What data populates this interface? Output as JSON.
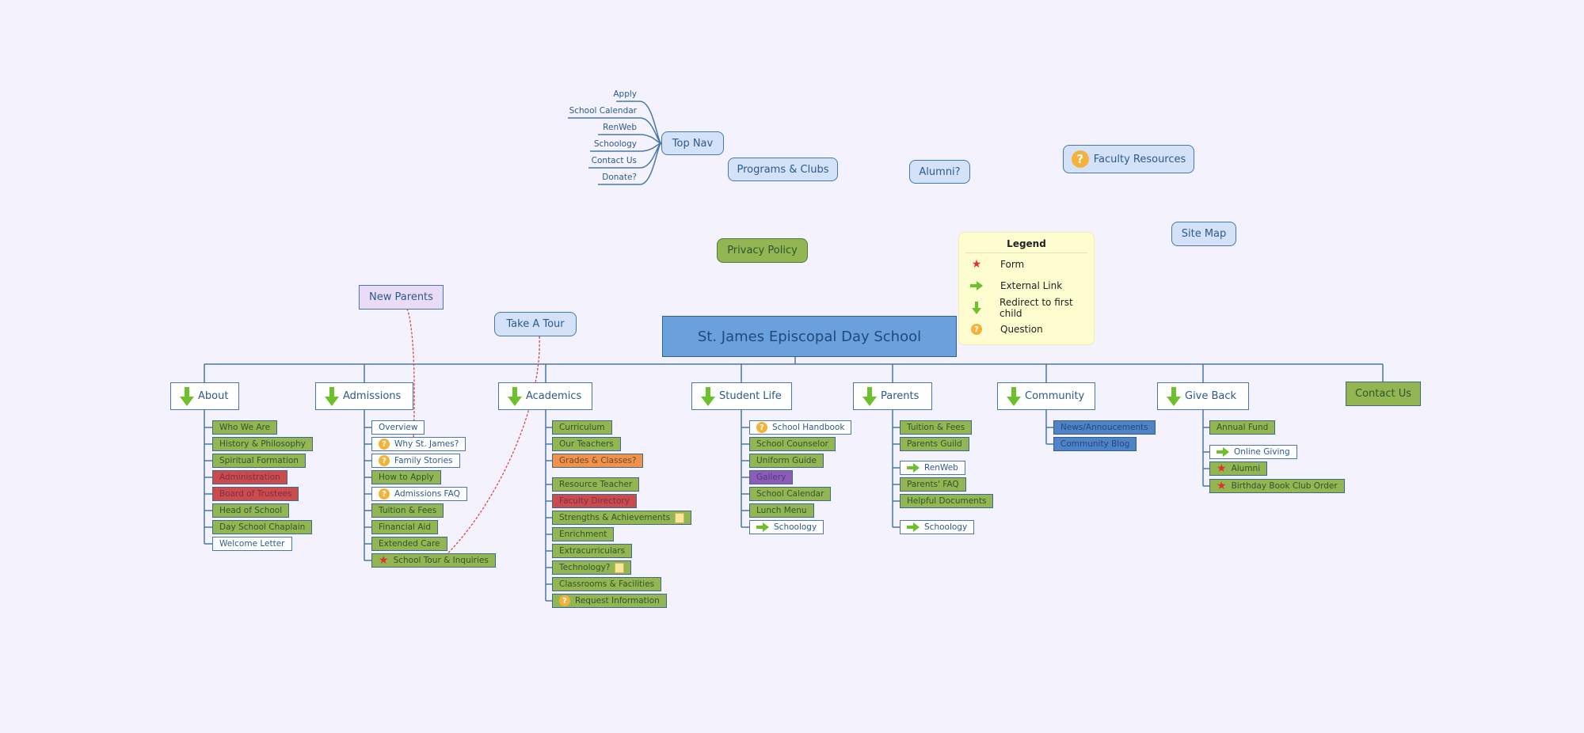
{
  "root": {
    "label": "St. James Episcopal Day School",
    "color": "#6aa0dc"
  },
  "floating": {
    "top_nav": "Top Nav",
    "programs_clubs": "Programs & Clubs",
    "alumni": "Alumni?",
    "faculty_resources": "Faculty Resources",
    "privacy_policy": "Privacy Policy",
    "site_map": "Site Map",
    "new_parents": "New Parents",
    "take_a_tour": "Take A Tour"
  },
  "top_nav_items": [
    "Apply",
    "School Calendar",
    "RenWeb",
    "Schoology",
    "Contact Us",
    "Donate?"
  ],
  "legend": {
    "title": "Legend",
    "items": [
      {
        "icon": "star-icon",
        "label": "Form"
      },
      {
        "icon": "arrow-right-icon",
        "label": "External Link"
      },
      {
        "icon": "arrow-down-icon",
        "label": "Redirect to first child"
      },
      {
        "icon": "question-icon",
        "label": "Question"
      }
    ]
  },
  "branches": [
    {
      "label": "About",
      "icon": "arrow-down-icon",
      "children": [
        {
          "label": "Who We Are",
          "style": "green"
        },
        {
          "label": "History & Philosophy",
          "style": "green"
        },
        {
          "label": "Spiritual Formation",
          "style": "green"
        },
        {
          "label": "Administration",
          "style": "red"
        },
        {
          "label": "Board of Trustees",
          "style": "red"
        },
        {
          "label": "Head of School",
          "style": "green"
        },
        {
          "label": "Day School Chaplain",
          "style": "green"
        },
        {
          "label": "Welcome Letter",
          "style": "white"
        }
      ]
    },
    {
      "label": "Admissions",
      "icon": "arrow-down-icon",
      "children": [
        {
          "label": "Overview",
          "style": "white"
        },
        {
          "label": "Why St. James?",
          "style": "white",
          "icon": "question-icon"
        },
        {
          "label": "Family Stories",
          "style": "white",
          "icon": "question-icon"
        },
        {
          "label": "How to Apply",
          "style": "green"
        },
        {
          "label": "Admissions FAQ",
          "style": "white",
          "icon": "question-icon"
        },
        {
          "label": "Tuition & Fees",
          "style": "green"
        },
        {
          "label": "Financial Aid",
          "style": "green"
        },
        {
          "label": "Extended Care",
          "style": "green"
        },
        {
          "label": "School Tour & Inquiries",
          "style": "green",
          "icon": "star-icon"
        }
      ]
    },
    {
      "label": "Academics",
      "icon": "arrow-down-icon",
      "children": [
        {
          "label": "Curriculum",
          "style": "green"
        },
        {
          "label": "Our Teachers",
          "style": "green"
        },
        {
          "label": "Grades & Classes?",
          "style": "orange"
        },
        {
          "label": "Resource Teacher",
          "style": "green"
        },
        {
          "label": "Faculty Directory",
          "style": "red"
        },
        {
          "label": "Strengths & Achievements",
          "style": "green",
          "note": true
        },
        {
          "label": "Enrichment",
          "style": "green"
        },
        {
          "label": "Extracurriculars",
          "style": "green"
        },
        {
          "label": "Technology?",
          "style": "green",
          "note": true
        },
        {
          "label": "Classrooms & Facilities",
          "style": "green"
        },
        {
          "label": "Request Information",
          "style": "green",
          "icon": "question-icon"
        }
      ]
    },
    {
      "label": "Student Life",
      "icon": "arrow-down-icon",
      "children": [
        {
          "label": "School Handbook",
          "style": "white",
          "icon": "question-icon"
        },
        {
          "label": "School Counselor",
          "style": "green"
        },
        {
          "label": "Uniform Guide",
          "style": "green"
        },
        {
          "label": "Gallery",
          "style": "purple"
        },
        {
          "label": "School Calendar",
          "style": "green"
        },
        {
          "label": "Lunch Menu",
          "style": "green"
        },
        {
          "label": "Schoology",
          "style": "white",
          "icon": "arrow-right-icon"
        }
      ]
    },
    {
      "label": "Parents",
      "icon": "arrow-down-icon",
      "children": [
        {
          "label": "Tuition & Fees",
          "style": "green"
        },
        {
          "label": "Parents Guild",
          "style": "green"
        },
        {
          "label": "RenWeb",
          "style": "white",
          "icon": "arrow-right-icon"
        },
        {
          "label": "Parents' FAQ",
          "style": "green"
        },
        {
          "label": "Helpful Documents",
          "style": "green"
        },
        {
          "label": "Schoology",
          "style": "white",
          "icon": "arrow-right-icon"
        }
      ]
    },
    {
      "label": "Community",
      "icon": "arrow-down-icon",
      "children": [
        {
          "label": "News/Annoucements",
          "style": "blue"
        },
        {
          "label": "Community Blog",
          "style": "blue"
        }
      ]
    },
    {
      "label": "Give Back",
      "icon": "arrow-down-icon",
      "children": [
        {
          "label": "Annual Fund",
          "style": "green"
        },
        {
          "label": "Online Giving",
          "style": "white",
          "icon": "arrow-right-icon"
        },
        {
          "label": "Alumni",
          "style": "green",
          "icon": "star-icon"
        },
        {
          "label": "Birthday Book Club Order",
          "style": "green",
          "icon": "star-icon"
        }
      ]
    },
    {
      "label": "Contact Us"
    }
  ]
}
